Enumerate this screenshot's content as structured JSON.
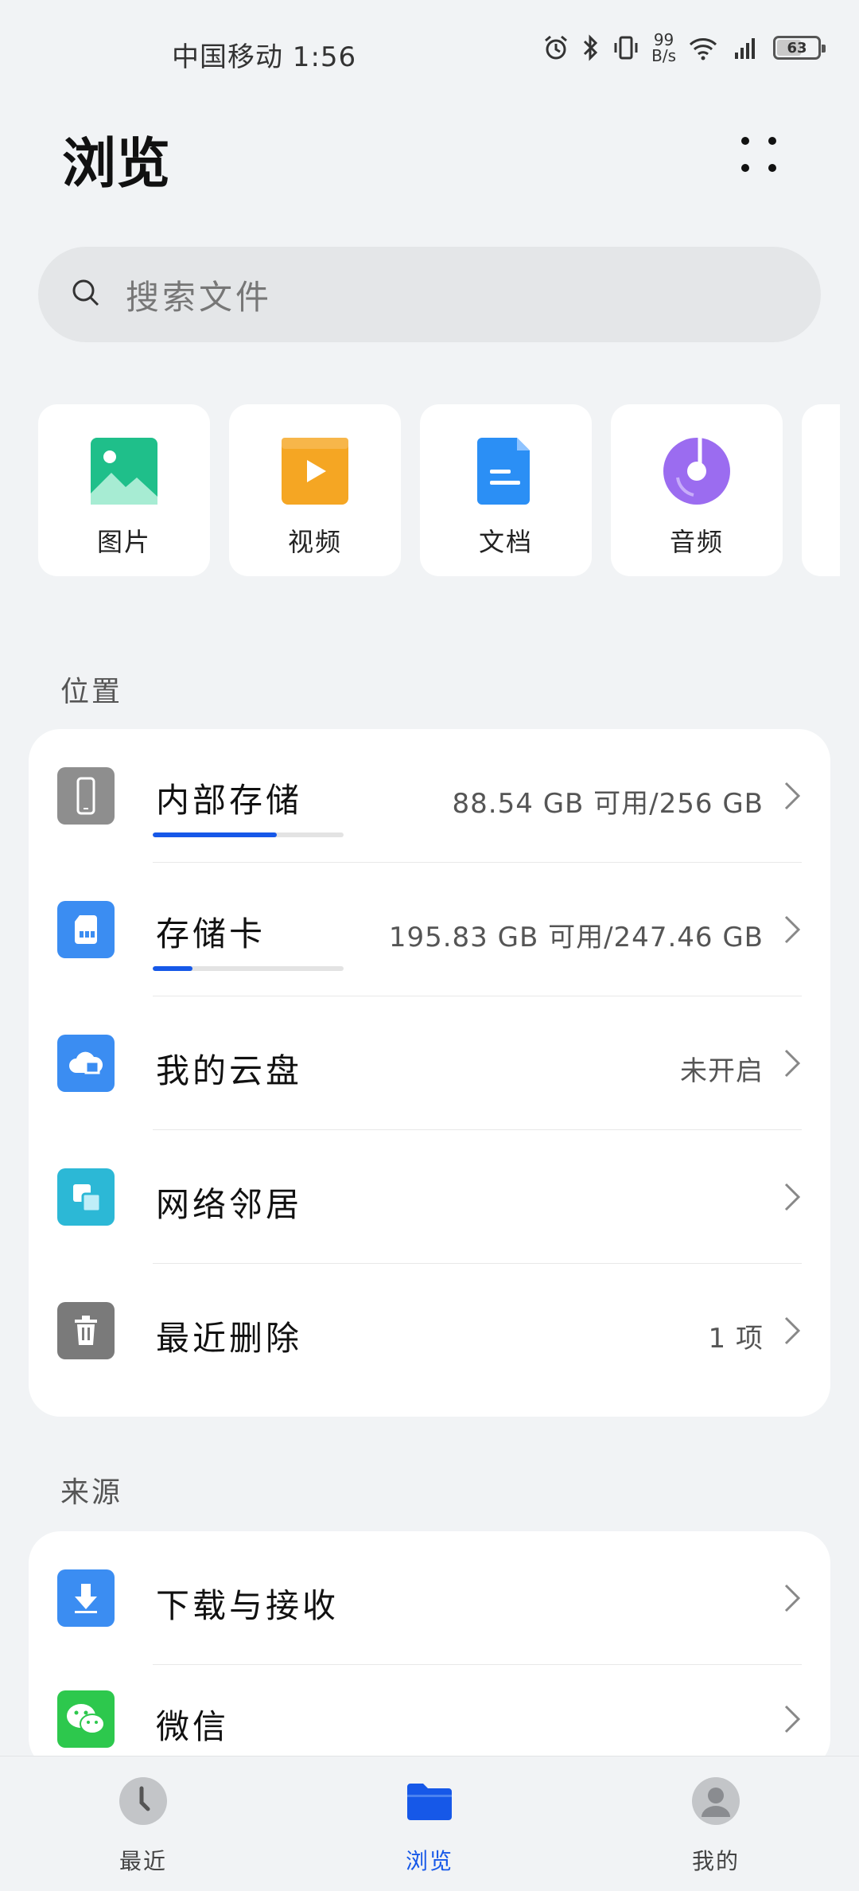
{
  "status_bar": {
    "carrier_time": "中国移动 1:56",
    "net_speed_value": "99",
    "net_speed_unit": "B/s",
    "battery_level": "63",
    "battery_fraction": 0.63
  },
  "header": {
    "title": "浏览"
  },
  "search": {
    "placeholder": "搜索文件"
  },
  "categories": [
    {
      "label": "图片",
      "icon": "image-icon",
      "color": "#1fbf8a"
    },
    {
      "label": "视频",
      "icon": "video-icon",
      "color": "#f5a623"
    },
    {
      "label": "文档",
      "icon": "document-icon",
      "color": "#2b8ff5"
    },
    {
      "label": "音频",
      "icon": "audio-icon",
      "color": "#9b6cf0"
    }
  ],
  "location": {
    "section_title": "位置",
    "items": [
      {
        "title": "内部存储",
        "value": "88.54 GB 可用/256 GB",
        "icon": "phone-icon",
        "color": "#8e8e8e",
        "used_fraction": 0.65
      },
      {
        "title": "存储卡",
        "value": "195.83 GB 可用/247.46 GB",
        "icon": "sd-card-icon",
        "color": "#3b8df2",
        "used_fraction": 0.21
      },
      {
        "title": "我的云盘",
        "value": "未开启",
        "icon": "cloud-drive-icon",
        "color": "#3b8df2"
      },
      {
        "title": "网络邻居",
        "value": "",
        "icon": "network-neighbor-icon",
        "color": "#2cb8d6"
      },
      {
        "title": "最近删除",
        "value": "1 项",
        "icon": "trash-icon",
        "color": "#7a7a7a"
      }
    ]
  },
  "source": {
    "section_title": "来源",
    "items": [
      {
        "title": "下载与接收",
        "icon": "download-icon",
        "color": "#3b8df2"
      },
      {
        "title": "微信",
        "icon": "wechat-icon",
        "color": "#2dc84d"
      }
    ]
  },
  "bottom_nav": {
    "items": [
      {
        "label": "最近",
        "icon": "clock-icon"
      },
      {
        "label": "浏览",
        "icon": "folder-icon",
        "active": true
      },
      {
        "label": "我的",
        "icon": "profile-icon"
      }
    ],
    "accent": "#1658e8"
  }
}
